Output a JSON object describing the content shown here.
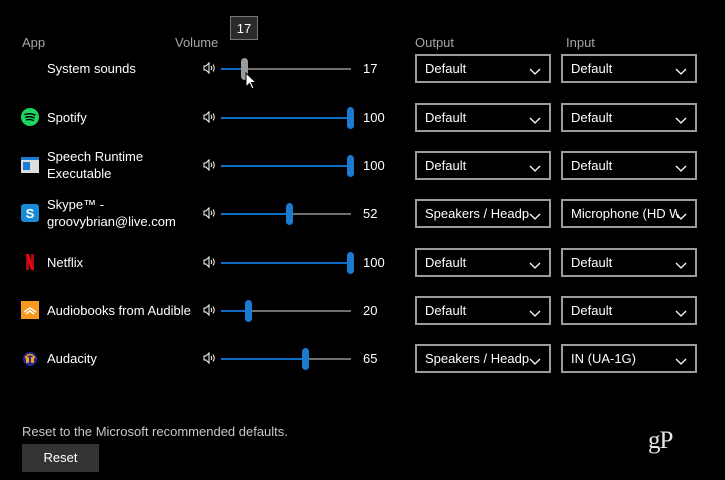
{
  "headers": {
    "app": "App",
    "volume": "Volume",
    "output": "Output",
    "input": "Input"
  },
  "tooltip": "17",
  "rows": [
    {
      "name": "System sounds",
      "volume": 17,
      "volume_label": "17",
      "output": "Default",
      "input": "Default",
      "icon": "none"
    },
    {
      "name": "Spotify",
      "volume": 100,
      "volume_label": "100",
      "output": "Default",
      "input": "Default",
      "icon": "spotify-icon"
    },
    {
      "name": "Speech Runtime\nExecutable",
      "volume": 100,
      "volume_label": "100",
      "output": "Default",
      "input": "Default",
      "icon": "speech-runtime-icon"
    },
    {
      "name": "Skype™ -\ngroovybrian@live.com",
      "volume": 52,
      "volume_label": "52",
      "output": "Speakers / Headp",
      "input": "Microphone (HD W",
      "icon": "skype-icon"
    },
    {
      "name": "Netflix",
      "volume": 100,
      "volume_label": "100",
      "output": "Default",
      "input": "Default",
      "icon": "netflix-icon"
    },
    {
      "name": "Audiobooks from Audible",
      "volume": 20,
      "volume_label": "20",
      "output": "Default",
      "input": "Default",
      "icon": "audible-icon"
    },
    {
      "name": "Audacity",
      "volume": 65,
      "volume_label": "65",
      "output": "Speakers / Headp",
      "input": "IN (UA-1G)",
      "icon": "audacity-icon"
    }
  ],
  "reset": {
    "text": "Reset to the Microsoft recommended defaults.",
    "button": "Reset"
  },
  "watermark": "gP",
  "colors": {
    "accent": "#1a7ad4",
    "background": "#000000",
    "spotify": "#1ed760",
    "skype": "#1a8ad4",
    "netflix": "#e50914",
    "audible": "#f7991c"
  }
}
